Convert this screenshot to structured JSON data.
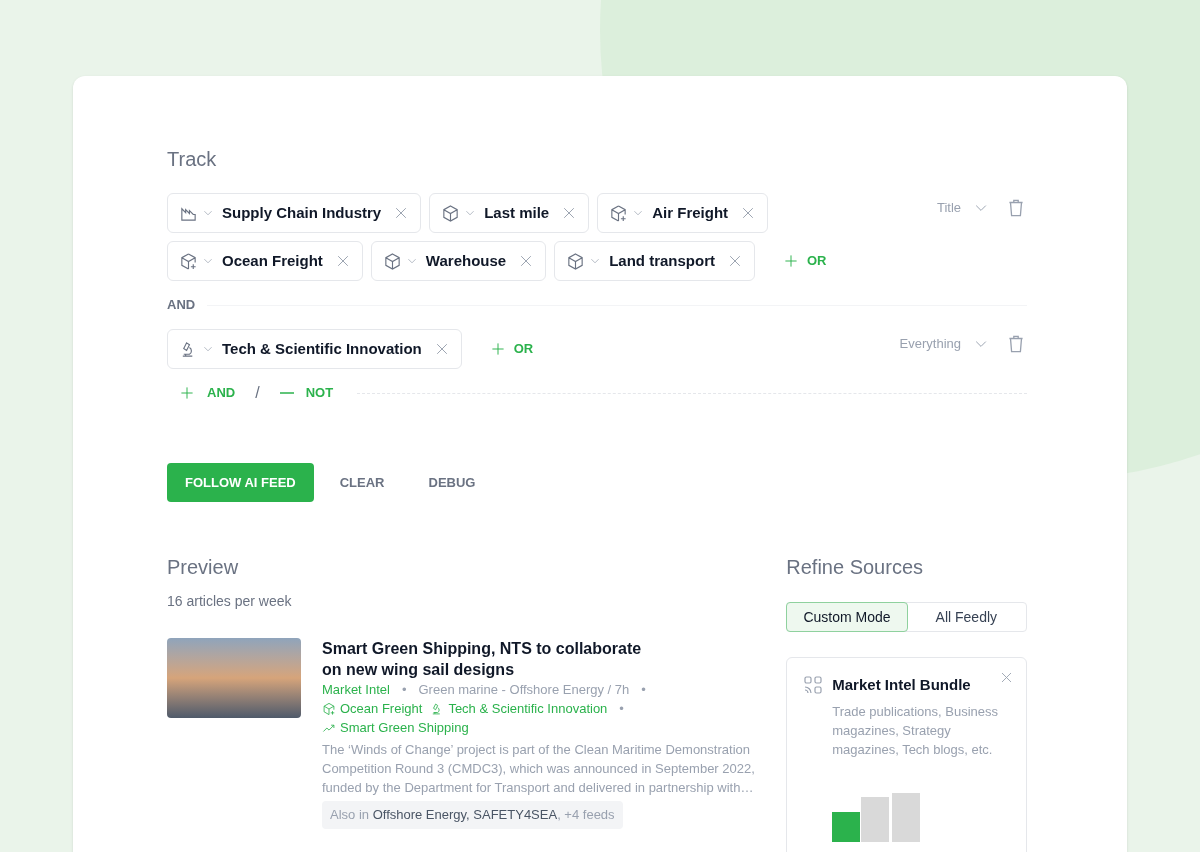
{
  "track": {
    "title": "Track",
    "groups": [
      {
        "chips": [
          {
            "label": "Supply Chain Industry",
            "kind": "industry"
          },
          {
            "label": "Last mile",
            "kind": "cube"
          },
          {
            "label": "Air Freight",
            "kind": "cube_spark"
          },
          {
            "label": "Ocean Freight",
            "kind": "cube_spark"
          },
          {
            "label": "Warehouse",
            "kind": "cube"
          },
          {
            "label": "Land transport",
            "kind": "cube"
          }
        ],
        "or_label": "OR",
        "scope": "Title"
      },
      {
        "chips": [
          {
            "label": "Tech & Scientific Innovation",
            "kind": "microscope"
          }
        ],
        "or_label": "OR",
        "scope": "Everything"
      }
    ],
    "operators": [
      "AND"
    ],
    "add_and": "AND",
    "separator": "/",
    "add_not": "NOT"
  },
  "actions": [
    {
      "label": "FOLLOW AI FEED",
      "kind": "primary"
    },
    {
      "label": "CLEAR",
      "kind": "text"
    },
    {
      "label": "DEBUG",
      "kind": "text"
    }
  ],
  "preview": {
    "title": "Preview",
    "subtitle": "16 articles per week",
    "articles": [
      {
        "title": "Smart Green Shipping, NTS to collaborate on new wing sail designs",
        "meta_lines": [
          [
            {
              "kind": "source",
              "text": "Market Intel"
            },
            {
              "kind": "dot",
              "text": "•"
            },
            {
              "kind": "text",
              "text": "Green marine - Offshore Energy / 7h"
            },
            {
              "kind": "dot",
              "text": "•"
            }
          ],
          [
            {
              "kind": "cube_spark",
              "text": "Ocean Freight"
            },
            {
              "kind": "microscope",
              "text": "Tech & Scientific Innovation"
            },
            {
              "kind": "dot",
              "text": "•"
            }
          ],
          [
            {
              "kind": "trend",
              "text": "Smart Green Shipping"
            }
          ]
        ],
        "summary": "The ‘Winds of Change’ project is part of the Clean Maritime Demonstration Competition Round 3 (CMDC3), which was announced in September 2022, funded by the Department for Transport and delivered in partnership with…",
        "also_in": [
          {
            "text": "Also in ",
            "em": false
          },
          {
            "text": "Offshore Energy, SAFETY4SEA",
            "em": true
          },
          {
            "text": ", +4 feeds",
            "em": false
          }
        ]
      }
    ]
  },
  "refine": {
    "title": "Refine Sources",
    "modes": [
      {
        "label": "Custom Mode",
        "selected": true
      },
      {
        "label": "All Feedly",
        "selected": false
      }
    ],
    "bundle": {
      "title": "Market Intel Bundle",
      "description": "Trade publications, Business magazines, Strategy magazines, Tech blogs, etc."
    }
  }
}
